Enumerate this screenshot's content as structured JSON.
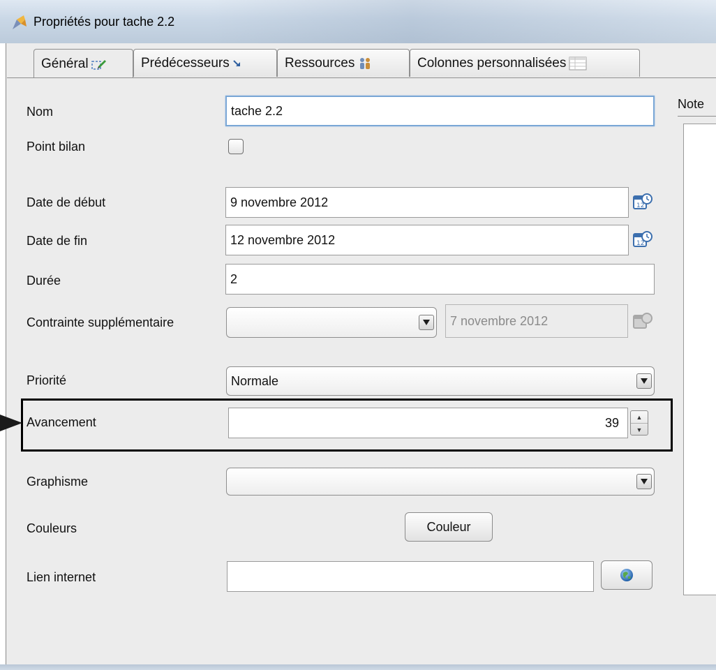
{
  "window": {
    "title": "Propriétés pour tache 2.2"
  },
  "tabs": [
    {
      "label": "Général",
      "icon": "edit-pencil-icon",
      "active": true
    },
    {
      "label": "Prédécesseurs",
      "icon": "arrow-down-right-icon",
      "active": false
    },
    {
      "label": "Ressources",
      "icon": "people-icon",
      "active": false
    },
    {
      "label": "Colonnes personnalisées",
      "icon": "table-icon",
      "active": false
    }
  ],
  "form": {
    "name": {
      "label": "Nom",
      "value": "tache 2.2"
    },
    "milestone": {
      "label": "Point bilan",
      "checked": false
    },
    "start_date": {
      "label": "Date de début",
      "value": "9 novembre 2012"
    },
    "end_date": {
      "label": "Date de fin",
      "value": "12 novembre 2012"
    },
    "duration": {
      "label": "Durée",
      "value": "2"
    },
    "constraint": {
      "label": "Contrainte supplémentaire",
      "value": "",
      "date": "7 novembre 2012"
    },
    "priority": {
      "label": "Priorité",
      "value": "Normale"
    },
    "progress": {
      "label": "Avancement",
      "value": "39"
    },
    "shape": {
      "label": "Graphisme",
      "value": ""
    },
    "colors": {
      "label": "Couleurs",
      "button": "Couleur"
    },
    "link": {
      "label": "Lien internet",
      "value": ""
    }
  },
  "notes": {
    "label": "Note"
  },
  "colors": {
    "focus_border": "#7aa7d6",
    "highlight_box": "#000000",
    "window_bg": "#ececec"
  }
}
